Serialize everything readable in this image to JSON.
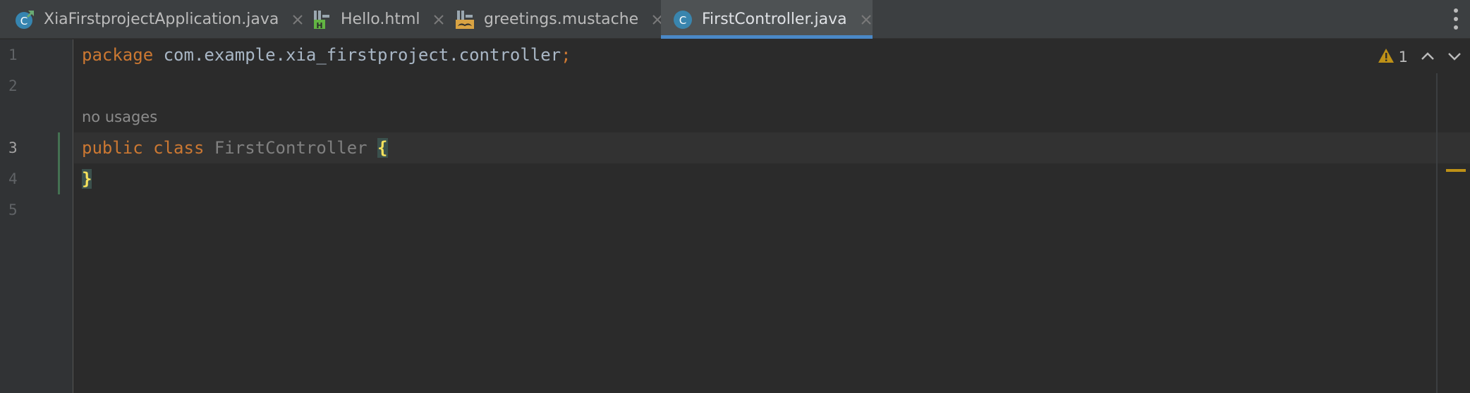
{
  "tabs": [
    {
      "label": "XiaFirstprojectApplication.java",
      "icon": "spring-boot-class-icon",
      "active": false
    },
    {
      "label": "Hello.html",
      "icon": "html-file-icon",
      "active": false
    },
    {
      "label": "greetings.mustache",
      "icon": "mustache-file-icon",
      "active": false
    },
    {
      "label": "FirstController.java",
      "icon": "java-class-icon",
      "active": true
    }
  ],
  "editor": {
    "line_numbers": [
      "1",
      "2",
      "3",
      "4",
      "5"
    ],
    "current_line": "3",
    "code": {
      "line1": {
        "keyword": "package",
        "package_name": " com.example.xia_firstproject.controller",
        "semicolon": ";"
      },
      "hint": "no usages",
      "line3": {
        "keyword1": "public",
        "keyword2": " class",
        "class_name": " FirstController",
        "space": " ",
        "brace": "{"
      },
      "line4": {
        "brace": "}"
      }
    }
  },
  "inspection": {
    "warning_count": "1",
    "colors": {
      "warning": "#be9117",
      "accent": "#4a88c7"
    }
  }
}
